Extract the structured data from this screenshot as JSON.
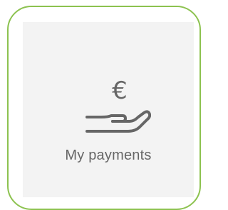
{
  "tile": {
    "label": "My payments",
    "icon": "hand-euro-icon",
    "accent_color": "#8cc24f",
    "text_color": "#666666",
    "background": "#f3f3f3"
  }
}
